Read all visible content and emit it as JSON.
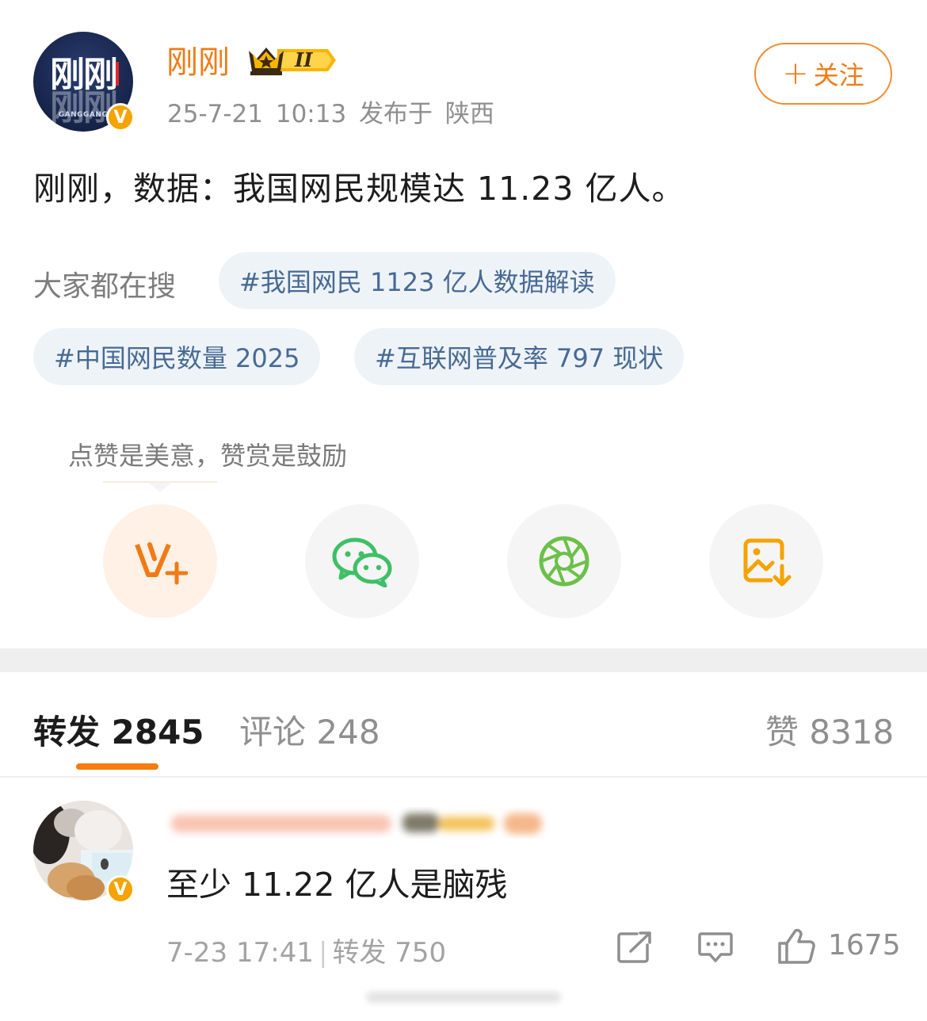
{
  "post": {
    "author_name": "刚刚",
    "avatar_text": "刚刚",
    "avatar_mirror_text": "刚刚",
    "avatar_subtext": "GANGGANG",
    "verified_mark": "V",
    "level_badge": "II",
    "time": "25-7-21 10:13",
    "location": "发布于 陕西",
    "follow_label": "关注",
    "follow_plus": "+",
    "content": "刚刚，数据：我国网民规模达 11.23 亿人。"
  },
  "search": {
    "label": "大家都在搜",
    "chips": [
      "#我国网民 1123 亿人数据解读",
      "#中国网民数量 2025",
      "#互联网普及率 797 现状"
    ]
  },
  "share": {
    "tip": "点赞是美意，赞赏是鼓励",
    "actions": [
      "vip-reward-icon",
      "wechat-icon",
      "moments-icon",
      "save-image-icon"
    ]
  },
  "tabs": {
    "repost_label": "转发",
    "repost_count": "2845",
    "comment_label": "评论",
    "comment_count": "248",
    "like_label": "赞",
    "like_count": "8318"
  },
  "comment": {
    "text": "至少 11.22 亿人是脑残",
    "time": "7-23 17:41",
    "separator": "|",
    "repost_label": "转发",
    "repost_count": "750",
    "like_count": "1675",
    "verified_mark": "V"
  },
  "colors": {
    "brand_orange": "#f07b16",
    "chip_bg": "#eef3f8",
    "chip_text": "#476a93",
    "wechat_green": "#3fbf67",
    "gold": "#f5a300"
  }
}
